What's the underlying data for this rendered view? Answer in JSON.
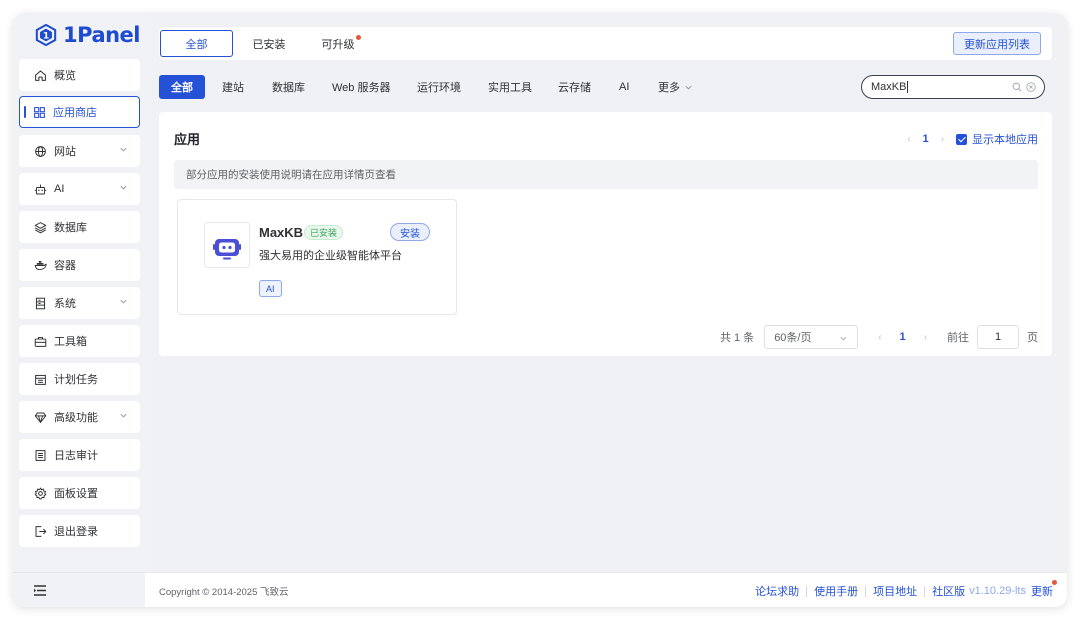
{
  "brand": {
    "name": "1Panel"
  },
  "sidebar": {
    "items": [
      {
        "label": "概览",
        "icon": "home-icon",
        "chevron": false
      },
      {
        "label": "应用商店",
        "icon": "apps-grid-icon",
        "chevron": false,
        "active": true
      },
      {
        "label": "网站",
        "icon": "globe-icon",
        "chevron": true
      },
      {
        "label": "AI",
        "icon": "robot-icon",
        "chevron": true
      },
      {
        "label": "数据库",
        "icon": "layers-icon",
        "chevron": false
      },
      {
        "label": "容器",
        "icon": "docker-whale-icon",
        "chevron": false
      },
      {
        "label": "系统",
        "icon": "server-icon",
        "chevron": true
      },
      {
        "label": "工具箱",
        "icon": "toolbox-icon",
        "chevron": false
      },
      {
        "label": "计划任务",
        "icon": "calendar-icon",
        "chevron": false
      },
      {
        "label": "高级功能",
        "icon": "diamond-icon",
        "chevron": true
      },
      {
        "label": "日志审计",
        "icon": "log-icon",
        "chevron": false
      },
      {
        "label": "面板设置",
        "icon": "settings-icon",
        "chevron": false
      },
      {
        "label": "退出登录",
        "icon": "logout-icon",
        "chevron": false
      }
    ]
  },
  "top_tabs": {
    "all": "全部",
    "installed": "已安装",
    "upgradable": "可升级",
    "refresh_label": "更新应用列表"
  },
  "categories": {
    "all": "全部",
    "website": "建站",
    "database": "数据库",
    "web_server": "Web 服务器",
    "runtime": "运行环境",
    "tools": "实用工具",
    "storage": "云存储",
    "ai": "AI",
    "more": "更多"
  },
  "search": {
    "value": "MaxKB"
  },
  "panel": {
    "title": "应用",
    "page": "1",
    "show_local_label": "显示本地应用",
    "notice": "部分应用的安装使用说明请在应用详情页查看"
  },
  "app": {
    "name": "MaxKB",
    "installed_tag": "已安装",
    "install_label": "安装",
    "description": "强大易用的企业级智能体平台",
    "tag": "AI"
  },
  "pagination": {
    "total": "共 1 条",
    "page_size": "60条/页",
    "current": "1",
    "goto_label": "前往",
    "goto_value": "1",
    "page_suffix": "页"
  },
  "footer": {
    "copyright": "Copyright © 2014-2025 飞致云",
    "links": [
      "论坛求助",
      "使用手册",
      "项目地址",
      "社区版"
    ],
    "version": "v1.10.29-lts",
    "update_label": "更新"
  },
  "colors": {
    "accent": "#2451d6",
    "badge_dot": "#e6563d",
    "installed_green": "#3aa25a"
  }
}
